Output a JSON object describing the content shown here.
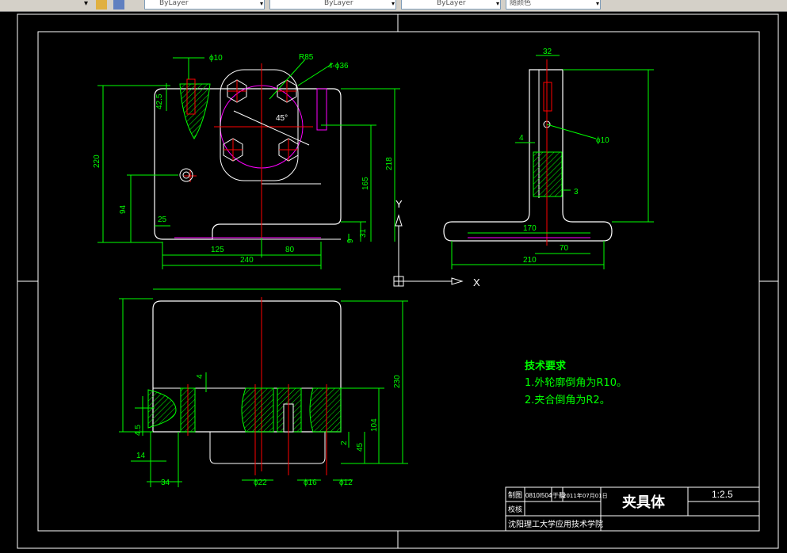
{
  "toolbar": {
    "linetype_value": "ByLayer",
    "lineweight_value": "ByLayer",
    "plotstyle_value": "ByLayer",
    "color_value": "随颜色"
  },
  "colors": {
    "background": "#000000",
    "outline": "#ffffff",
    "dimension": "#00ff00",
    "centerline": "#ff0000",
    "hidden": "#ff00ff",
    "hatch": "#00ff00",
    "text_yellow": "#ffff00",
    "leader": "#00ff00"
  },
  "drawing": {
    "ucs": {
      "y_label": "Y",
      "x_label": "X"
    },
    "top_view_dims": {
      "phi10": "ϕ10",
      "r85": "R85",
      "holes": "4-ϕ36",
      "d42_5": "42.5",
      "d220": "220",
      "d218": "218",
      "d165": "165",
      "d94": "94",
      "d25": "25",
      "d125": "125",
      "d80": "80",
      "d240": "240",
      "d31": "31",
      "d9": "9",
      "angle": "45°"
    },
    "side_view_dims": {
      "d32": "32",
      "d4": "4",
      "phi10": "ϕ10",
      "d3": "3",
      "d170": "170",
      "d70": "70",
      "d210": "210"
    },
    "front_view_dims": {
      "d4": "4",
      "d230": "230",
      "d104": "104",
      "d45": "45",
      "d2": "2",
      "d4_5": "4.5",
      "d14": "14",
      "d34": "34",
      "phi22": "ϕ22",
      "phi16": "ϕ16",
      "phi12": "ϕ12"
    },
    "tech_requirements": {
      "title": "技术要求",
      "item1": "1.外轮廓倒角为R10。",
      "item2": "2.夹合倒角为R2。"
    }
  },
  "title_block": {
    "draw_label": "制图",
    "draw_value": "0810I504",
    "date_label": "于翻",
    "date_value": "2011年07月01日",
    "check_label": "校核",
    "part_name": "夹具体",
    "scale": "1:2.5",
    "school": "沈阳理工大学应用技术学院"
  }
}
